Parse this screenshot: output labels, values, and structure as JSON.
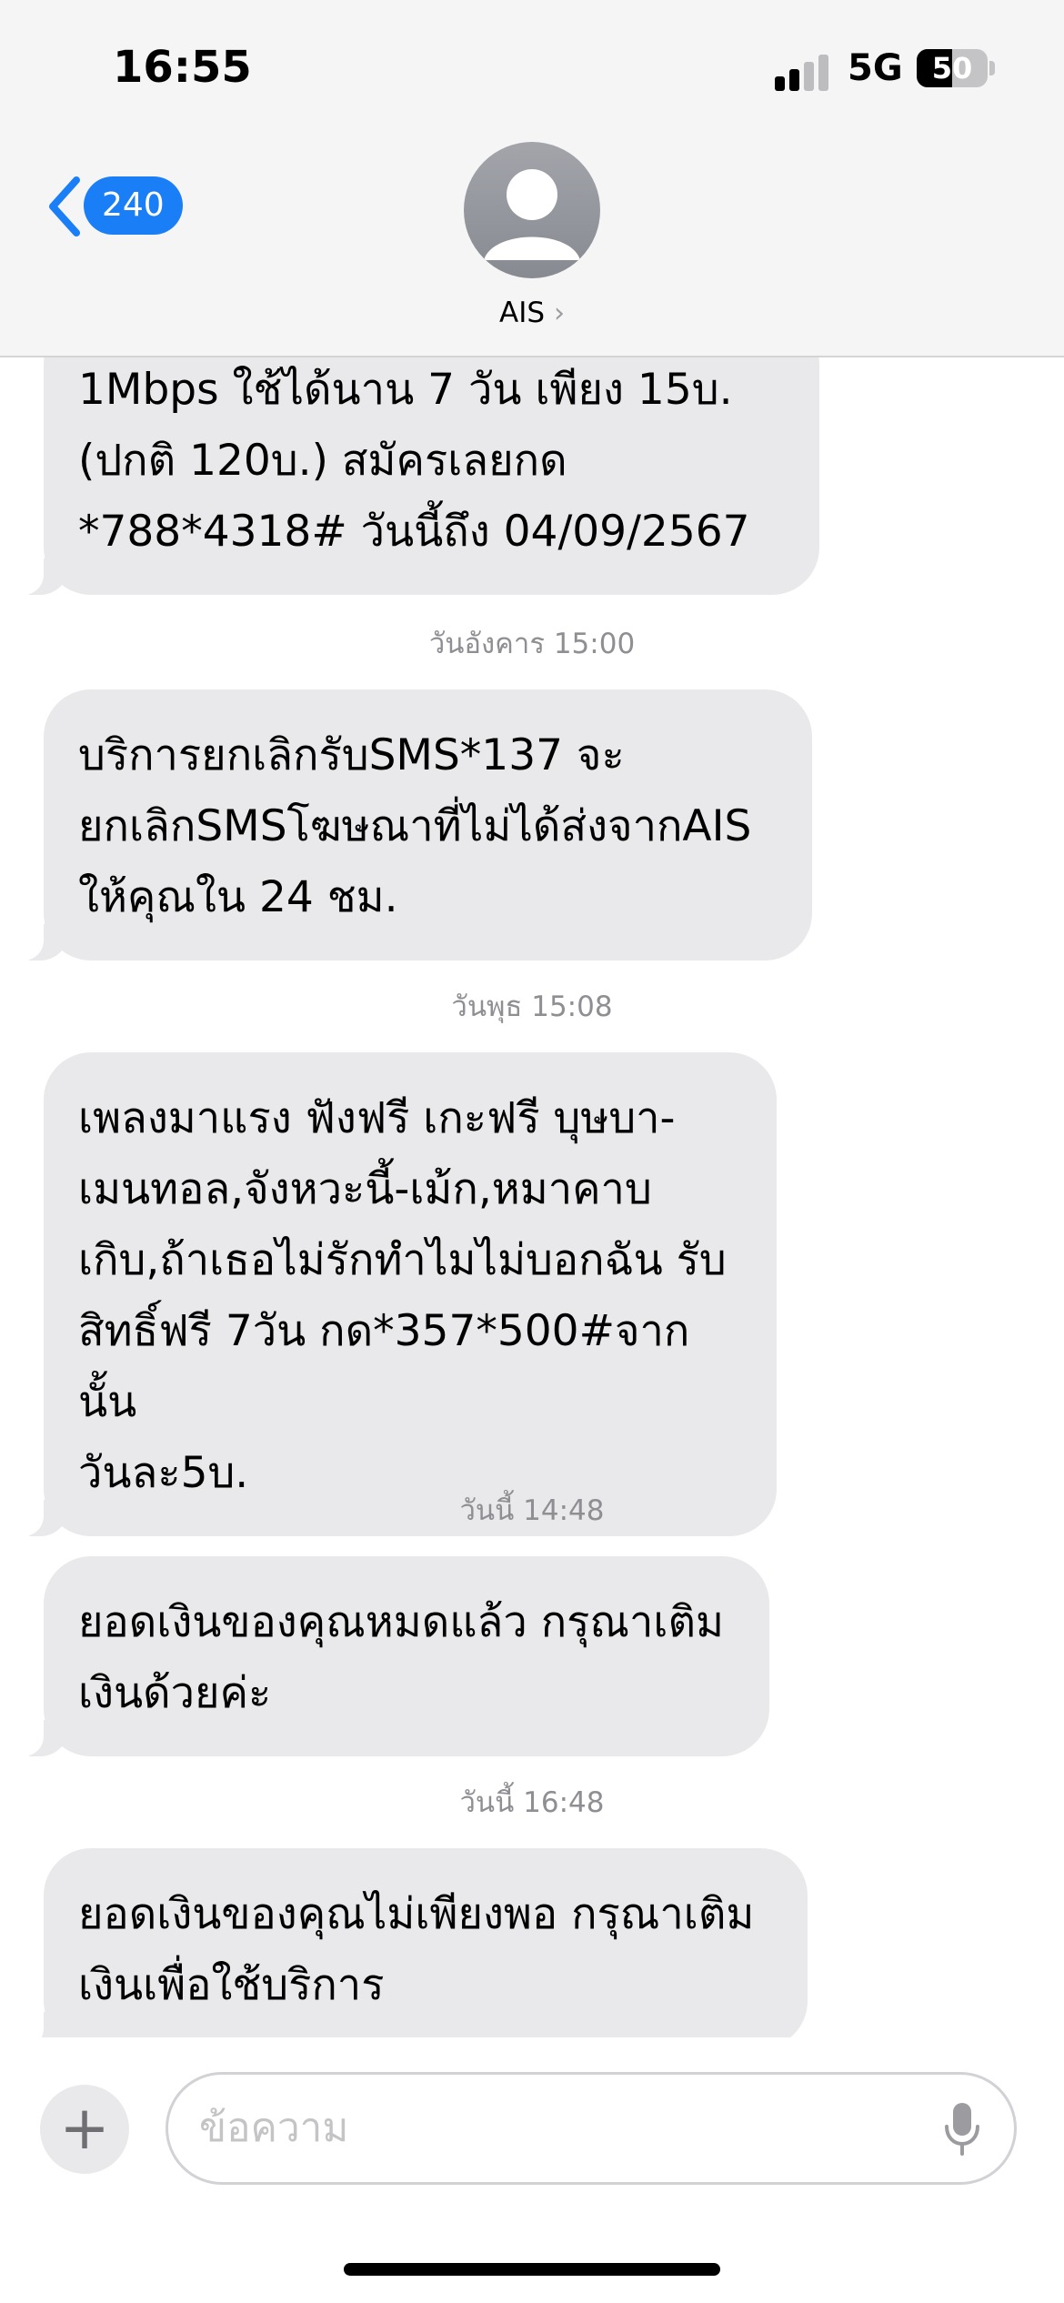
{
  "status_bar": {
    "time": "16:55",
    "network": "5G",
    "battery_level": 50,
    "battery_text": "50"
  },
  "header": {
    "back_count": "240",
    "contact_name": "AIS",
    "contact_chevron": "›",
    "colors": {
      "accent": "#1a7ef7",
      "background": "#f5f5f5"
    },
    "icons": [
      "chevron-left-icon",
      "person-avatar-icon",
      "chevron-right-icon"
    ]
  },
  "thread": [
    {
      "kind": "message",
      "text": "1Mbps ใช้ได้นาน 7 วัน เพียง 15บ.\n(ปกติ 120บ.) สมัครเลยกด\n*788*4318# วันนี้ถึง 04/09/2567"
    },
    {
      "kind": "timestamp",
      "text": "วันอังคาร 15:00"
    },
    {
      "kind": "message",
      "text": "บริการยกเลิกรับSMS*137 จะ\nยกเลิกSMSโฆษณาที่ไม่ได้ส่งจากAIS\nให้คุณใน 24 ชม."
    },
    {
      "kind": "timestamp",
      "text": "วันพุธ 15:08"
    },
    {
      "kind": "message",
      "text": "เพลงมาแรง ฟังฟรี เกะฟรี บุษบา-\nเมนทอล,จังหวะนี้-เม้ก,หมาคาบ\nเกิบ,ถ้าเธอไม่รักทำไมไม่บอกฉัน รับ\nสิทธิ์ฟรี 7วัน กด*357*500#จากนั้น\nวันละ5บ."
    },
    {
      "kind": "timestamp",
      "text": "วันนี้ 14:48"
    },
    {
      "kind": "message",
      "text": "ยอดเงินของคุณหมดแล้ว กรุณาเติม\nเงินด้วยค่ะ"
    },
    {
      "kind": "timestamp",
      "text": "วันนี้ 16:48"
    },
    {
      "kind": "message",
      "text": "ยอดเงินของคุณไม่เพียงพอ กรุณาเติม\nเงินเพื่อใช้บริการ"
    }
  ],
  "input": {
    "add_label": "+",
    "placeholder": "ข้อความ",
    "icons": [
      "plus-icon",
      "microphone-icon"
    ]
  },
  "bubble_color": "#e9e9eb"
}
